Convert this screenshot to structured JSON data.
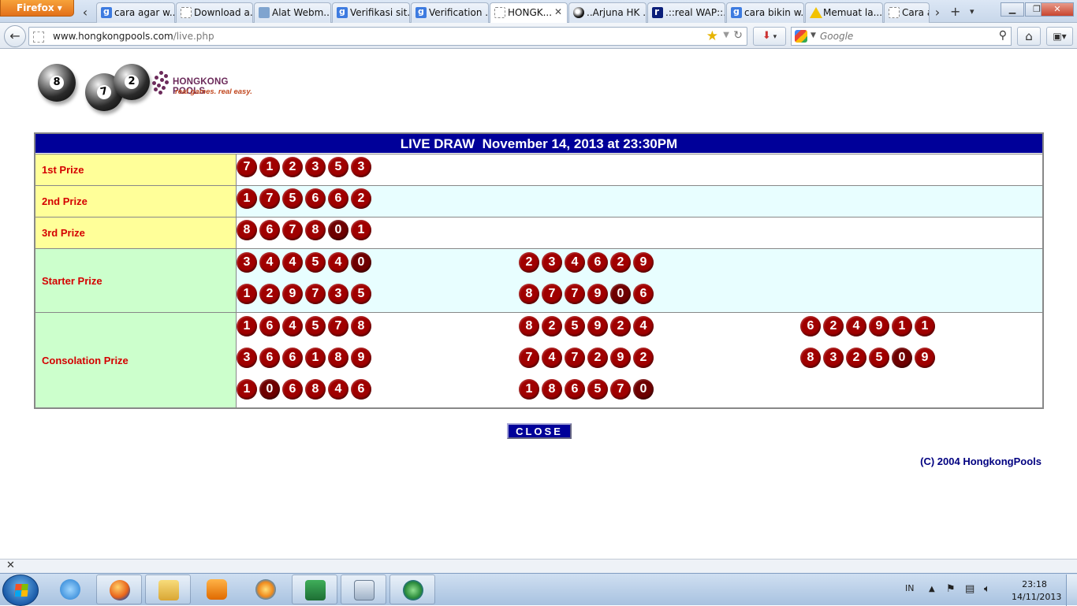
{
  "browser": {
    "app_button": "Firefox",
    "tabs": [
      {
        "label": "cara agar w...",
        "icon": "google-icon"
      },
      {
        "label": "Download a...",
        "icon": "blank-page-icon"
      },
      {
        "label": "Alat Webm...",
        "icon": "webmaster-icon"
      },
      {
        "label": "Verifikasi sit...",
        "icon": "google-icon"
      },
      {
        "label": "Verification ...",
        "icon": "google-icon"
      },
      {
        "label": "HONGK...",
        "icon": "blank-page-icon",
        "active": true
      },
      {
        "label": "..Arjuna HK ...",
        "icon": "ball-icon"
      },
      {
        "label": ".::real WAP::.",
        "icon": "r-icon"
      },
      {
        "label": "cara bikin w...",
        "icon": "google-icon"
      },
      {
        "label": "Memuat la...",
        "icon": "warning-icon"
      },
      {
        "label": "Cara a",
        "icon": "blank-page-icon"
      }
    ],
    "url_domain": "www.hongkongpools.com",
    "url_path": "/live.php",
    "search_placeholder": "Google"
  },
  "logo": {
    "balls": [
      "8",
      "7",
      "2"
    ],
    "name": "HONGKONG POOLS",
    "tagline": "real games. real easy."
  },
  "live_draw": {
    "header": "LIVE DRAW  November 14, 2013 at 23:30PM",
    "prizes": [
      {
        "label": "1st Prize",
        "sets": [
          [
            "7",
            "1",
            "2",
            "3",
            "5",
            "3"
          ]
        ]
      },
      {
        "label": "2nd Prize",
        "sets": [
          [
            "1",
            "7",
            "5",
            "6",
            "6",
            "2"
          ]
        ]
      },
      {
        "label": "3rd Prize",
        "sets": [
          [
            "8",
            "6",
            "7",
            "8",
            "0",
            "1"
          ]
        ]
      },
      {
        "label": "Starter Prize",
        "sets": [
          [
            "3",
            "4",
            "4",
            "5",
            "4",
            "0"
          ],
          [
            "2",
            "3",
            "4",
            "6",
            "2",
            "9"
          ],
          [
            "1",
            "2",
            "9",
            "7",
            "3",
            "5"
          ],
          [
            "8",
            "7",
            "7",
            "9",
            "0",
            "6"
          ]
        ]
      },
      {
        "label": "Consolation Prize",
        "sets": [
          [
            "1",
            "6",
            "4",
            "5",
            "7",
            "8"
          ],
          [
            "8",
            "2",
            "5",
            "9",
            "2",
            "4"
          ],
          [
            "6",
            "2",
            "4",
            "9",
            "1",
            "1"
          ],
          [
            "3",
            "6",
            "6",
            "1",
            "8",
            "9"
          ],
          [
            "7",
            "4",
            "7",
            "2",
            "9",
            "2"
          ],
          [
            "8",
            "3",
            "2",
            "5",
            "0",
            "9"
          ],
          [
            "1",
            "0",
            "6",
            "8",
            "4",
            "6"
          ],
          [
            "1",
            "8",
            "6",
            "5",
            "7",
            "0"
          ]
        ]
      }
    ],
    "close_label": "CLOSE",
    "copyright": "(C) 2004 HongkongPools"
  },
  "taskbar": {
    "apps": [
      "ie-icon",
      "firefox-icon",
      "explorer-icon",
      "media-player-icon",
      "media-center-icon",
      "excel-icon",
      "calculator-icon",
      "network-icon"
    ],
    "lang": "IN",
    "time": "23:18",
    "date": "14/11/2013"
  }
}
